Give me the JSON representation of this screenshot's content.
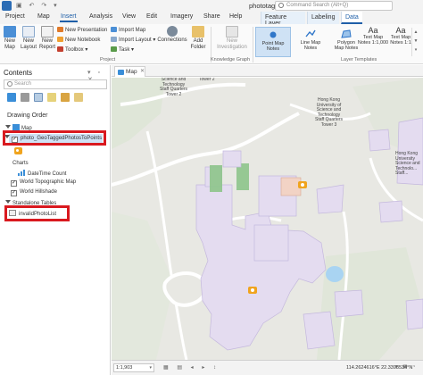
{
  "title_bar": {
    "doc_title": "phototag",
    "search_placeholder": "Command Search (Alt+Q)",
    "quick_access": "▣ ↶ ↷ ▾"
  },
  "ribbon_tabs": [
    "Project",
    "Map",
    "Insert",
    "Analysis",
    "View",
    "Edit",
    "Imagery",
    "Share",
    "Help"
  ],
  "active_tab": "Insert",
  "context_tabs": [
    "Feature Layer",
    "Labeling",
    "Data"
  ],
  "ribbon": {
    "project_group": {
      "label": "Project",
      "new_map": "New\nMap",
      "new_layout": "New\nLayout",
      "new_report": "New\nReport",
      "new_presentation": "New Presentation",
      "new_notebook": "New Notebook",
      "toolbox": "Toolbox",
      "import_map": "Import Map",
      "import_layout": "Import Layout",
      "task": "Task",
      "connections": "Connections",
      "add_folder": "Add\nFolder"
    },
    "knowledge_group": {
      "label": "Knowledge Graph",
      "new_investigation": "New\nInvestigation"
    },
    "layer_templates": {
      "label": "Layer Templates",
      "items": [
        "Point Map\nNotes",
        "Line Map\nNotes",
        "Polygon\nMap Notes",
        "Text Map\nNotes 1:1,000",
        "Text Map\nNotes 1:1"
      ]
    }
  },
  "contents": {
    "title": "Contents",
    "search_placeholder": "Search",
    "drawing_order": "Drawing Order",
    "map_item": "Map",
    "selected_layer": "photo_GeoTaggedPhotosToPoints",
    "charts_label": "Charts",
    "chart_item": "DateTime Count",
    "basemap_layers": [
      "World Topographic Map",
      "World Hillshade"
    ],
    "standalone_tables_label": "Standalone Tables",
    "standalone_table": "invalidPhotoList"
  },
  "map_view": {
    "tab_label": "Map",
    "labels": {
      "top_left": "Science and\nTechnology\nStaff Quarters\nTower 2",
      "tower2_small": "Tower 2",
      "top_right": "Hong Kong\nUniversity of\nScience and\nTechnology\nStaff Quarters\nTower 3",
      "right_edge": "Hong Kong\nUniversity\nScience and\nTechnolo...\nStaff..."
    }
  },
  "status_bar": {
    "scale": "1:1,903",
    "coordinates": "114.2624616°E 22.3398534°N",
    "icons": "▦ ▤ ◂ ▸ ↕"
  },
  "colors": {
    "accent": "#1f5fa8",
    "selection_highlight": "#cfe2f5",
    "annotation_red": "#d9191f",
    "building_fill": "#e4dcf0",
    "photo_marker": "#f0a41e"
  }
}
